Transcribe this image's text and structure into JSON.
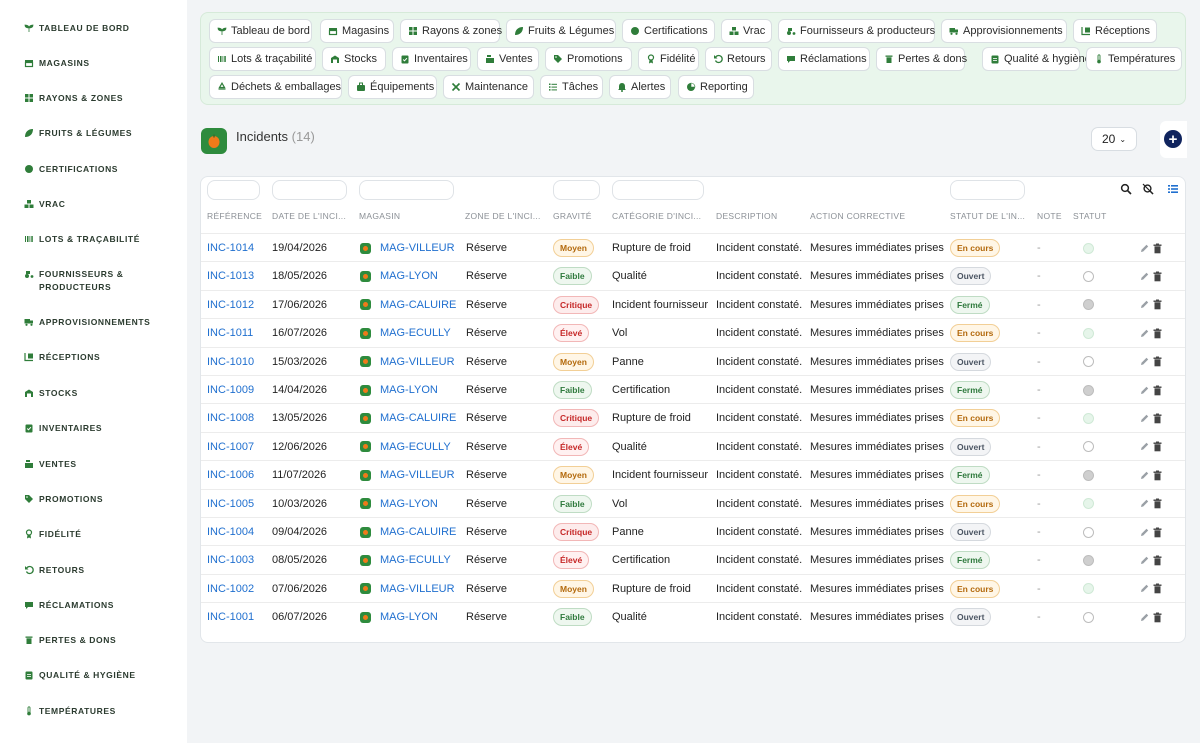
{
  "sidebar": {
    "items": [
      {
        "label": "Tableau de bord",
        "icon": "seedling-icon"
      },
      {
        "label": "Magasins",
        "icon": "store-icon"
      },
      {
        "label": "Rayons & zones",
        "icon": "grid-icon"
      },
      {
        "label": "Fruits & légumes",
        "icon": "leaf-icon"
      },
      {
        "label": "Certifications",
        "icon": "certificate-icon"
      },
      {
        "label": "Vrac",
        "icon": "boxes-icon"
      },
      {
        "label": "Lots & traçabilité",
        "icon": "barcode-icon"
      },
      {
        "label": "Fournisseurs & producteurs",
        "icon": "tractor-icon"
      },
      {
        "label": "Approvisionnements",
        "icon": "truck-icon"
      },
      {
        "label": "Réceptions",
        "icon": "dolly-icon"
      },
      {
        "label": "Stocks",
        "icon": "warehouse-icon"
      },
      {
        "label": "Inventaires",
        "icon": "clipboard-check-icon"
      },
      {
        "label": "Ventes",
        "icon": "cash-register-icon"
      },
      {
        "label": "Promotions",
        "icon": "tag-icon"
      },
      {
        "label": "Fidélité",
        "icon": "award-icon"
      },
      {
        "label": "Retours",
        "icon": "undo-icon"
      },
      {
        "label": "Réclamations",
        "icon": "comment-icon"
      },
      {
        "label": "Pertes & dons",
        "icon": "trash-icon"
      },
      {
        "label": "Qualité & hygiène",
        "icon": "clipboard-icon"
      },
      {
        "label": "Températures",
        "icon": "thermometer-icon"
      }
    ]
  },
  "topnav": {
    "chips": [
      {
        "label": "Tableau de bord",
        "icon": "seedling-icon"
      },
      {
        "label": "Magasins",
        "icon": "store-icon"
      },
      {
        "label": "Rayons & zones",
        "icon": "grid-icon"
      },
      {
        "label": "Fruits & Légumes",
        "icon": "leaf-icon"
      },
      {
        "label": "Certifications",
        "icon": "certificate-icon"
      },
      {
        "label": "Vrac",
        "icon": "boxes-icon"
      },
      {
        "label": "Fournisseurs & producteurs",
        "icon": "tractor-icon"
      },
      {
        "label": "Approvisionnements",
        "icon": "truck-icon"
      },
      {
        "label": "Réceptions",
        "icon": "dolly-icon"
      },
      {
        "label": "Lots & traçabilité",
        "icon": "barcode-icon"
      },
      {
        "label": "Stocks",
        "icon": "warehouse-icon"
      },
      {
        "label": "Inventaires",
        "icon": "clipboard-check-icon"
      },
      {
        "label": "Ventes",
        "icon": "cash-register-icon"
      },
      {
        "label": "Promotions",
        "icon": "tag-icon"
      },
      {
        "label": "Fidélité",
        "icon": "award-icon"
      },
      {
        "label": "Retours",
        "icon": "undo-icon"
      },
      {
        "label": "Réclamations",
        "icon": "comment-icon"
      },
      {
        "label": "Pertes & dons",
        "icon": "trash-icon"
      },
      {
        "label": "Qualité & hygiène",
        "icon": "clipboard-icon"
      },
      {
        "label": "Températures",
        "icon": "thermometer-icon"
      },
      {
        "label": "Déchets & emballages",
        "icon": "recycle-icon"
      },
      {
        "label": "Équipements",
        "icon": "tools-icon"
      },
      {
        "label": "Maintenance",
        "icon": "wrench-icon"
      },
      {
        "label": "Tâches",
        "icon": "list-icon"
      },
      {
        "label": "Alertes",
        "icon": "bell-icon"
      },
      {
        "label": "Reporting",
        "icon": "chart-pie-icon"
      }
    ]
  },
  "page": {
    "title": "Incidents",
    "count": "(14)",
    "per_page": "20",
    "add_label": "+"
  },
  "table": {
    "headers": [
      "Référence",
      "Date de l'inci...",
      "Magasin",
      "Zone de l'inci...",
      "Gravité",
      "Catégorie d'inci...",
      "Description",
      "Action corrective",
      "Statut de l'in...",
      "Note",
      "Statut"
    ],
    "rows": [
      {
        "ref": "INC-1014",
        "date": "19/04/2026",
        "magasin": "MAG-VILLEUR",
        "zone": "Réserve",
        "gravite": "Moyen",
        "categorie": "Rupture de froid",
        "description": "Incident constaté.",
        "action": "Mesures immédiates prises",
        "statut": "En cours",
        "note": "-"
      },
      {
        "ref": "INC-1013",
        "date": "18/05/2026",
        "magasin": "MAG-LYON",
        "zone": "Réserve",
        "gravite": "Faible",
        "categorie": "Qualité",
        "description": "Incident constaté.",
        "action": "Mesures immédiates prises",
        "statut": "Ouvert",
        "note": "-"
      },
      {
        "ref": "INC-1012",
        "date": "17/06/2026",
        "magasin": "MAG-CALUIRE",
        "zone": "Réserve",
        "gravite": "Critique",
        "categorie": "Incident fournisseur",
        "description": "Incident constaté.",
        "action": "Mesures immédiates prises",
        "statut": "Fermé",
        "note": "-"
      },
      {
        "ref": "INC-1011",
        "date": "16/07/2026",
        "magasin": "MAG-ECULLY",
        "zone": "Réserve",
        "gravite": "Élevé",
        "categorie": "Vol",
        "description": "Incident constaté.",
        "action": "Mesures immédiates prises",
        "statut": "En cours",
        "note": "-"
      },
      {
        "ref": "INC-1010",
        "date": "15/03/2026",
        "magasin": "MAG-VILLEUR",
        "zone": "Réserve",
        "gravite": "Moyen",
        "categorie": "Panne",
        "description": "Incident constaté.",
        "action": "Mesures immédiates prises",
        "statut": "Ouvert",
        "note": "-"
      },
      {
        "ref": "INC-1009",
        "date": "14/04/2026",
        "magasin": "MAG-LYON",
        "zone": "Réserve",
        "gravite": "Faible",
        "categorie": "Certification",
        "description": "Incident constaté.",
        "action": "Mesures immédiates prises",
        "statut": "Fermé",
        "note": "-"
      },
      {
        "ref": "INC-1008",
        "date": "13/05/2026",
        "magasin": "MAG-CALUIRE",
        "zone": "Réserve",
        "gravite": "Critique",
        "categorie": "Rupture de froid",
        "description": "Incident constaté.",
        "action": "Mesures immédiates prises",
        "statut": "En cours",
        "note": "-"
      },
      {
        "ref": "INC-1007",
        "date": "12/06/2026",
        "magasin": "MAG-ECULLY",
        "zone": "Réserve",
        "gravite": "Élevé",
        "categorie": "Qualité",
        "description": "Incident constaté.",
        "action": "Mesures immédiates prises",
        "statut": "Ouvert",
        "note": "-"
      },
      {
        "ref": "INC-1006",
        "date": "11/07/2026",
        "magasin": "MAG-VILLEUR",
        "zone": "Réserve",
        "gravite": "Moyen",
        "categorie": "Incident fournisseur",
        "description": "Incident constaté.",
        "action": "Mesures immédiates prises",
        "statut": "Fermé",
        "note": "-"
      },
      {
        "ref": "INC-1005",
        "date": "10/03/2026",
        "magasin": "MAG-LYON",
        "zone": "Réserve",
        "gravite": "Faible",
        "categorie": "Vol",
        "description": "Incident constaté.",
        "action": "Mesures immédiates prises",
        "statut": "En cours",
        "note": "-"
      },
      {
        "ref": "INC-1004",
        "date": "09/04/2026",
        "magasin": "MAG-CALUIRE",
        "zone": "Réserve",
        "gravite": "Critique",
        "categorie": "Panne",
        "description": "Incident constaté.",
        "action": "Mesures immédiates prises",
        "statut": "Ouvert",
        "note": "-"
      },
      {
        "ref": "INC-1003",
        "date": "08/05/2026",
        "magasin": "MAG-ECULLY",
        "zone": "Réserve",
        "gravite": "Élevé",
        "categorie": "Certification",
        "description": "Incident constaté.",
        "action": "Mesures immédiates prises",
        "statut": "Fermé",
        "note": "-"
      },
      {
        "ref": "INC-1002",
        "date": "07/06/2026",
        "magasin": "MAG-VILLEUR",
        "zone": "Réserve",
        "gravite": "Moyen",
        "categorie": "Rupture de froid",
        "description": "Incident constaté.",
        "action": "Mesures immédiates prises",
        "statut": "En cours",
        "note": "-"
      },
      {
        "ref": "INC-1001",
        "date": "06/07/2026",
        "magasin": "MAG-LYON",
        "zone": "Réserve",
        "gravite": "Faible",
        "categorie": "Qualité",
        "description": "Incident constaté.",
        "action": "Mesures immédiates prises",
        "statut": "Ouvert",
        "note": "-"
      }
    ]
  },
  "colors": {
    "accent_green": "#2f7d3a",
    "link_blue": "#1f6fcf",
    "add_button": "#10245e",
    "nav_bg": "#e9f6ec"
  }
}
